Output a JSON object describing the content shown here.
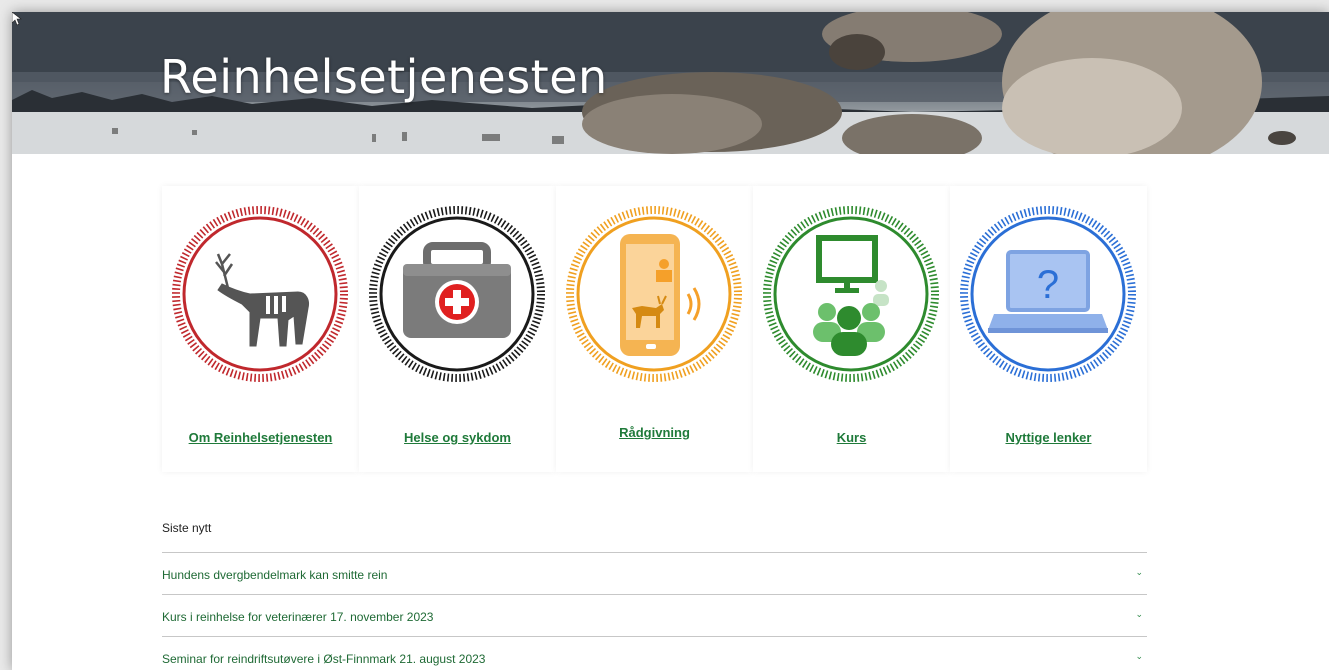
{
  "header": {
    "site_title": "Reinhelsetjenesten"
  },
  "tiles": [
    {
      "label": "Om Reinhelsetjenesten",
      "color": "#c0282d",
      "icon": "reindeer-icon"
    },
    {
      "label": "Helse og sykdom",
      "color": "#1a1a1a",
      "icon": "first-aid-kit-icon"
    },
    {
      "label": "Rådgivning",
      "color": "#f0a020",
      "icon": "phone-advice-icon"
    },
    {
      "label": "Kurs",
      "color": "#2e8b2e",
      "icon": "course-audience-icon"
    },
    {
      "label": "Nyttige lenker",
      "color": "#2b6fd6",
      "icon": "laptop-question-icon"
    }
  ],
  "news": {
    "heading": "Siste nytt",
    "items": [
      "Hundens dvergbendelmark kan smitte rein",
      "Kurs i reinhelse for veterinærer 17. november 2023",
      "Seminar for reindriftsutøvere i Øst-Finnmark 21. august 2023"
    ],
    "link_color": "#1f6a35"
  }
}
